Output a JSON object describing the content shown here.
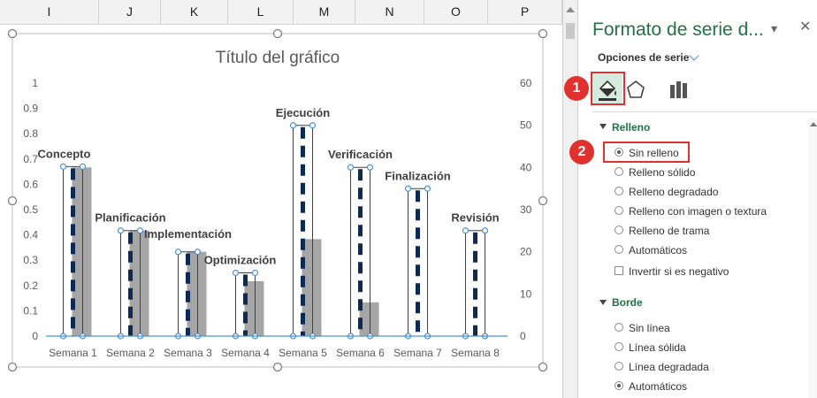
{
  "sheet": {
    "columns": [
      "I",
      "J",
      "K",
      "L",
      "M",
      "N",
      "O",
      "P"
    ]
  },
  "chart_data": {
    "type": "bar",
    "title": "Título del gráfico",
    "categories": [
      "Semana 1",
      "Semana 2",
      "Semana 3",
      "Semana 4",
      "Semana 5",
      "Semana 6",
      "Semana 7",
      "Semana 8"
    ],
    "series": [
      {
        "axis": "primary",
        "fill": "none",
        "outline": "#000000",
        "values": [
          0.67,
          0.417,
          0.333,
          0.25,
          0.833,
          0.667,
          0.583,
          0.417
        ],
        "data_labels": [
          "Concepto",
          "Planificación",
          "Implementación",
          "Optimización",
          "Ejecución",
          "Verificación",
          "Finalización",
          "Revisión"
        ]
      },
      {
        "axis": "secondary",
        "fill": "#a6a6a6",
        "values": [
          40,
          25,
          20,
          13,
          23,
          8,
          0,
          0
        ]
      }
    ],
    "y_primary": {
      "min": 0,
      "max": 1,
      "step": 0.1,
      "ticks": [
        "0",
        "0.1",
        "0.2",
        "0.3",
        "0.4",
        "0.5",
        "0.6",
        "0.7",
        "0.8",
        "0.9",
        "1"
      ]
    },
    "y_secondary": {
      "min": 0,
      "max": 60,
      "step": 10,
      "ticks": [
        "0",
        "10",
        "20",
        "30",
        "40",
        "50",
        "60"
      ]
    },
    "dashed_line_color": "#0f2a52",
    "gridlines": false,
    "legend": "none"
  },
  "panel": {
    "title": "Formato de serie d...",
    "series_options_label": "Opciones de serie",
    "badge1": "1",
    "badge2": "2",
    "tabs": [
      {
        "icon": "paint-bucket-icon",
        "selected": true
      },
      {
        "icon": "pentagon-icon",
        "selected": false
      },
      {
        "icon": "bar-chart-icon",
        "selected": false
      }
    ],
    "fill_section": {
      "title": "Relleno",
      "options": [
        "Sin relleno",
        "Relleno sólido",
        "Relleno degradado",
        "Relleno con imagen o textura",
        "Relleno de trama",
        "Automáticos"
      ],
      "selected": 0,
      "invert_label": "Invertir si es negativo"
    },
    "border_section": {
      "title": "Borde",
      "options": [
        "Sin línea",
        "Línea sólida",
        "Línea degradada",
        "Automáticos"
      ],
      "selected": 3
    }
  },
  "colors": {
    "accent": "#217346",
    "highlight": "#e0312f",
    "selection": "#4a90d9"
  }
}
